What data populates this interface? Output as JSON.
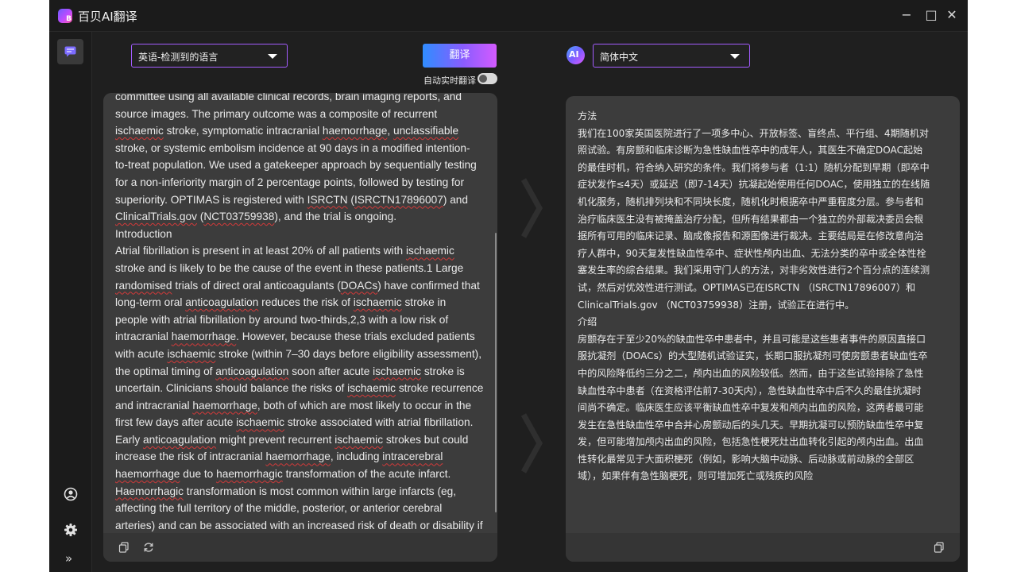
{
  "titlebar": {
    "logo_letter": "B",
    "app_title": "百贝AI翻译",
    "minimize_glyph": "−",
    "maximize_glyph": "□",
    "close_glyph": "✕"
  },
  "sidebar": {
    "items": [
      {
        "name": "translate",
        "icon": "chat-bubble-icon",
        "active": true
      },
      {
        "name": "account",
        "icon": "user-circle-icon"
      },
      {
        "name": "settings",
        "icon": "gear-icon"
      },
      {
        "name": "expand",
        "icon": "double-chevron-icon"
      }
    ],
    "expand_glyph": "»"
  },
  "toolbar": {
    "source_language": "英语-检测到的语言",
    "translate_label": "翻译",
    "auto_translate_label": "自动实时翻译",
    "auto_translate_enabled": false,
    "ai_badge": "AI",
    "target_language": "简体中文"
  },
  "source": {
    "lines": [
      [
        {
          "t": "committee using all available clinical records, brain imaging reports, and"
        }
      ],
      [
        {
          "t": "source images. The primary outcome was a composite of recurrent"
        }
      ],
      [
        {
          "t": "ischaemic",
          "u": true
        },
        {
          "t": " stroke, symptomatic intracranial "
        },
        {
          "t": "haemorrhage",
          "u": true
        },
        {
          "t": ", "
        },
        {
          "t": "unclassifiable",
          "u": true
        }
      ],
      [
        {
          "t": "stroke, or systemic embolism incidence at 90 days in a modified intention-"
        }
      ],
      [
        {
          "t": "to-treat population. We used a gatekeeper approach by sequentially testing"
        }
      ],
      [
        {
          "t": "for a non-inferiority margin of 2 percentage points, followed by testing for"
        }
      ],
      [
        {
          "t": "superiority. OPTIMAS is registered with "
        },
        {
          "t": "ISRCTN",
          "u": true
        },
        {
          "t": " ("
        },
        {
          "t": "ISRCTN17896007",
          "u": true
        },
        {
          "t": ") and"
        }
      ],
      [
        {
          "t": "ClinicalTrials.gov",
          "u": true
        },
        {
          "t": " ("
        },
        {
          "t": "NCT03759938",
          "u": true
        },
        {
          "t": "), and the trial is ongoing."
        }
      ],
      [
        {
          "t": "Introduction"
        }
      ],
      [
        {
          "t": "Atrial fibrillation is present in at least 20% of all patients with "
        },
        {
          "t": "ischaemic",
          "u": true
        }
      ],
      [
        {
          "t": "stroke and is likely to be the cause of the event in these patients.1 Large"
        }
      ],
      [
        {
          "t": "randomised",
          "u": true
        },
        {
          "t": " trials of direct oral anticoagulants ("
        },
        {
          "t": "DOACs",
          "u": true
        },
        {
          "t": ") have confirmed that"
        }
      ],
      [
        {
          "t": "long-term oral "
        },
        {
          "t": "anticoagulation",
          "u": true
        },
        {
          "t": " reduces the risk of "
        },
        {
          "t": "ischaemic",
          "u": true
        },
        {
          "t": " stroke in"
        }
      ],
      [
        {
          "t": "people with atrial fibrillation by around two-thirds,2,3 with a low risk of"
        }
      ],
      [
        {
          "t": "intracranial "
        },
        {
          "t": "haemorrhage",
          "u": true
        },
        {
          "t": ". However, because these trials excluded patients"
        }
      ],
      [
        {
          "t": "with acute "
        },
        {
          "t": "ischaemic",
          "u": true
        },
        {
          "t": " stroke (within 7–30 days before eligibility assessment),"
        }
      ],
      [
        {
          "t": "the optimal timing of "
        },
        {
          "t": "anticoagulation",
          "u": true
        },
        {
          "t": " soon after acute "
        },
        {
          "t": "ischaemic",
          "u": true
        },
        {
          "t": " stroke is"
        }
      ],
      [
        {
          "t": "uncertain. Clinicians should balance the risks of "
        },
        {
          "t": "ischaemic",
          "u": true
        },
        {
          "t": " stroke recurrence"
        }
      ],
      [
        {
          "t": "and intracranial "
        },
        {
          "t": "haemorrhage",
          "u": true
        },
        {
          "t": ", both of which are most likely to occur in the"
        }
      ],
      [
        {
          "t": "first few days after acute "
        },
        {
          "t": "ischaemic",
          "u": true
        },
        {
          "t": " stroke associated with atrial fibrillation."
        }
      ],
      [
        {
          "t": "Early "
        },
        {
          "t": "anticoagulation",
          "u": true
        },
        {
          "t": " might prevent recurrent "
        },
        {
          "t": "ischaemic",
          "u": true
        },
        {
          "t": " strokes but could"
        }
      ],
      [
        {
          "t": "increase the risk of intracranial "
        },
        {
          "t": "haemorrhage",
          "u": true
        },
        {
          "t": ", including "
        },
        {
          "t": "intracerebral",
          "u": true
        }
      ],
      [
        {
          "t": "haemorrhage",
          "u": true
        },
        {
          "t": " due to "
        },
        {
          "t": "haemorrhagic",
          "u": true
        },
        {
          "t": " transformation of the acute infarct."
        }
      ],
      [
        {
          "t": "Haemorrhagic",
          "u": true
        },
        {
          "t": " transformation is most common within large infarcts (eg,"
        }
      ],
      [
        {
          "t": "affecting the full territory of the middle, posterior, or anterior cerebral"
        }
      ],
      [
        {
          "t": "arteries) and can be associated with an increased risk of death or disability if"
        }
      ]
    ]
  },
  "target": {
    "lines": [
      "方法",
      "我们在100家英国医院进行了一项多中心、开放标签、盲终点、平行组、4期随机对",
      "照试验。有房颤和临床诊断为急性缺血性卒中的成年人，其医生不确定DOAC起始",
      "的最佳时机，符合纳入研究的条件。我们将参与者（1:1）随机分配到早期（即卒中",
      "症状发作≤4天）或延迟（即7-14天）抗凝起始使用任何DOAC，使用独立的在线随",
      "机化服务，随机排列块和不同块长度，随机化时根据卒中严重程度分层。参与者和",
      "治疗临床医生没有被掩盖治疗分配，但所有结果都由一个独立的外部裁决委员会根",
      "据所有可用的临床记录、脑成像报告和源图像进行裁决。主要结局是在修改意向治",
      "疗人群中，90天复发性缺血性卒中、症状性颅内出血、无法分类的卒中或全体性栓",
      "塞发生率的综合结果。我们采用守门人的方法，对非劣效性进行2个百分点的连续测",
      "试，然后对优效性进行测试。OPTIMAS已在ISRCTN （ISRCTN17896007）和",
      "ClinicalTrials.gov （NCT03759938）注册，试验正在进行中。",
      "介绍",
      "房颤存在于至少20%的缺血性卒中患者中，并且可能是这些患者事件的原因直接口",
      "服抗凝剂（DOACs）的大型随机试验证实，长期口服抗凝剂可使房颤患者缺血性卒",
      "中的风险降低约三分之二，颅内出血的风险较低。然而，由于这些试验排除了急性",
      "缺血性卒中患者（在资格评估前7-30天内），急性缺血性卒中后不久的最佳抗凝时",
      "间尚不确定。临床医生应该平衡缺血性卒中复发和颅内出血的风险，这两者最可能",
      "发生在急性缺血性卒中合并心房颤动后的头几天。早期抗凝可以预防缺血性卒中复",
      "发，但可能增加颅内出血的风险，包括急性梗死灶出血转化引起的颅内出血。出血",
      "性转化最常见于大面积梗死（例如，影响大脑中动脉、后动脉或前动脉的全部区",
      "域），如果伴有急性脑梗死，则可增加死亡或残疾的风险"
    ]
  },
  "icons": {
    "source_footer": [
      "copy-icon",
      "refresh-icon"
    ],
    "target_footer": [
      "copy-icon"
    ]
  }
}
